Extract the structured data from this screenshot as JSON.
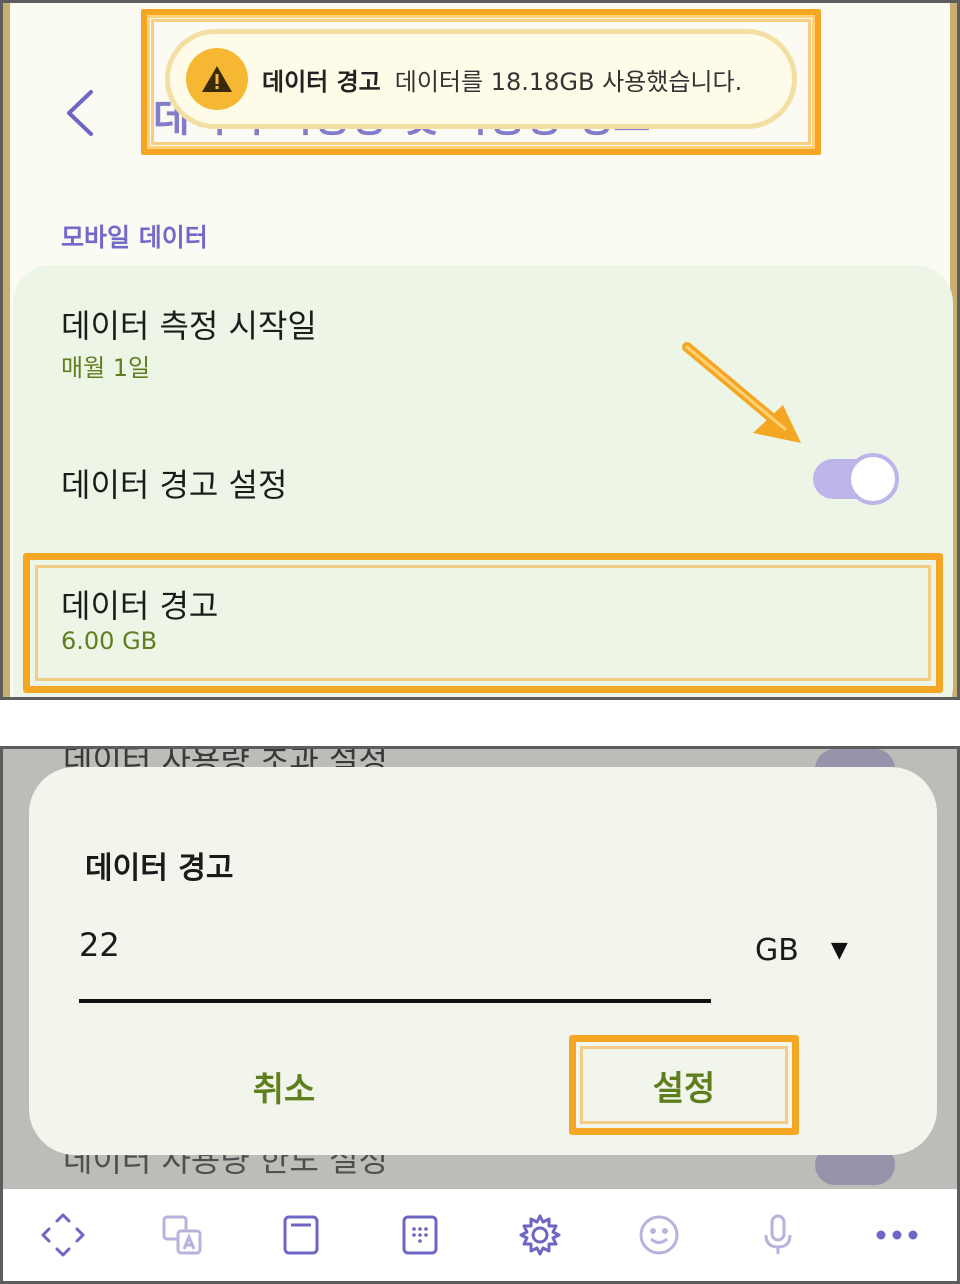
{
  "colors": {
    "accent_purple": "#7369c9",
    "accent_green": "#5f7f1f",
    "highlight_orange": "#f5a623",
    "card_green": "#edf5e7"
  },
  "top": {
    "obscured_header_title": "데이터 사용량 및 사용량 경고",
    "toast": {
      "icon": "warning-icon",
      "title": "데이터 경고",
      "message": "데이터를 18.18GB 사용했습니다."
    },
    "section_title": "모바일 데이터",
    "rows": {
      "cycle_title": "데이터 측정 시작일",
      "cycle_value": "매월 1일",
      "warning_setting_title": "데이터 경고 설정",
      "warning_setting_on": true,
      "warning_title": "데이터 경고",
      "warning_value": "6.00 GB"
    }
  },
  "bottom": {
    "peek_top": "데이터 사용량 초과 설정",
    "peek_bottom": "데이터 사용량 한도 설정",
    "dialog": {
      "title": "데이터 경고",
      "input_value": "22",
      "unit": "GB",
      "cancel": "취소",
      "confirm": "설정"
    },
    "toolbar_icons": [
      "move-cursor-icon",
      "translate-icon",
      "clipboard-icon",
      "keypad-icon",
      "settings-icon",
      "emoji-icon",
      "microphone-icon",
      "more-icon"
    ]
  }
}
